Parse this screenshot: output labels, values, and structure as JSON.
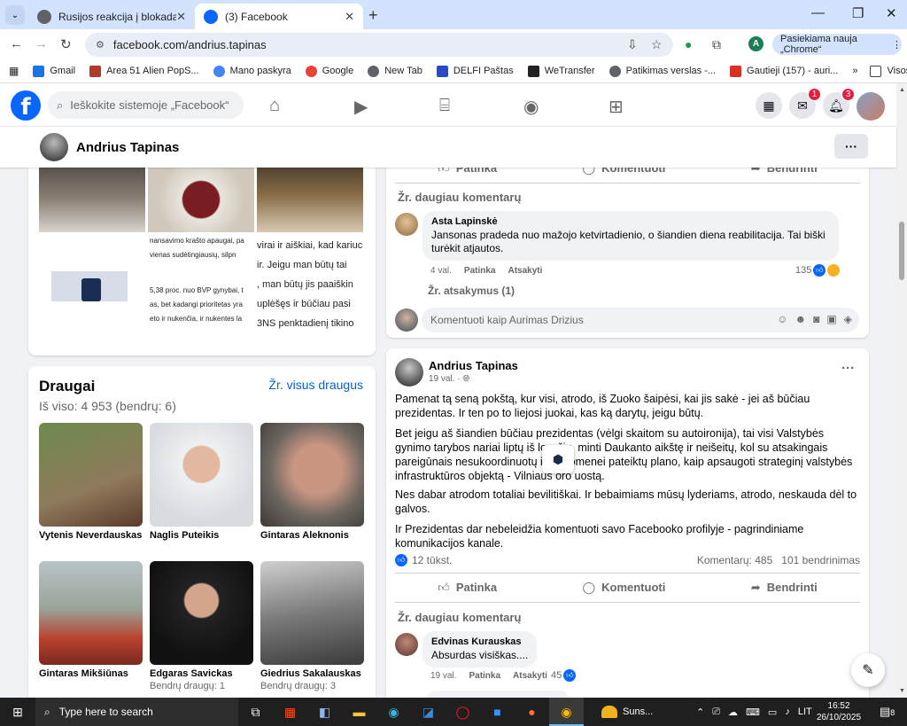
{
  "browser": {
    "tabs": [
      {
        "title": "Rusijos reakcija į blokadą",
        "active": false
      },
      {
        "title": "(3) Facebook",
        "active": true
      }
    ],
    "url": "facebook.com/andrius.tapinas",
    "profile_initial": "A",
    "update_label": "Pasiekiama nauja „Chrome“",
    "bookmarks": [
      "Gmail",
      "Area 51 Alien PopS...",
      "Mano paskyra",
      "Google",
      "New Tab",
      "DELFI Paštas",
      "WeTransfer",
      "Patikimas verslas -...",
      "Gautieji (157) - auri..."
    ],
    "all_bookmarks": "Visos žymės"
  },
  "facebook": {
    "search_placeholder": "Ieškokite sistemoje „Facebook“",
    "messenger_badge": "1",
    "notifications_badge": "3",
    "profile_name": "Andrius Tapinas",
    "accent": "#0866ff"
  },
  "photos": {
    "snippet_middle": [
      "nansavimo krašto apaugai, pa",
      "vienas sudėtingiausių, silpn",
      "",
      "5,38 proc. nuo BVP gynybai, t",
      "as, bet kadangi prioritetas yra",
      "eto ir nukenčia, ir nukentes la"
    ],
    "snippet_right": [
      "virai ir aiškiai, kad kariuc",
      "ir. Jeigu man būtų tai",
      ", man būtų jis paaiškin",
      "uplėšęs ir būčiau pasi",
      "3NS penktadienį tikino"
    ]
  },
  "friends": {
    "title": "Draugai",
    "see_all": "Žr. visus draugus",
    "count_text": "Iš viso: 4 953 (bendrų: 6)",
    "list": [
      {
        "name": "Vytenis Neverdauskas",
        "mutual": ""
      },
      {
        "name": "Naglis Puteikis",
        "mutual": ""
      },
      {
        "name": "Gintaras Aleknonis",
        "mutual": ""
      },
      {
        "name": "Gintaras Mikšiūnas",
        "mutual": ""
      },
      {
        "name": "Edgaras Savickas",
        "mutual": "Bendrų draugų: 1"
      },
      {
        "name": "Giedrius Sakalauskas",
        "mutual": "Bendrų draugų: 3"
      }
    ]
  },
  "post1": {
    "actions": {
      "like": "Patinka",
      "comment": "Komentuoti",
      "share": "Bendrinti"
    },
    "more_comments": "Žr. daugiau komentarų",
    "comment": {
      "author": "Asta Lapinskė",
      "text": "Jansonas pradeda nuo mažojo ketvirtadienio, o šiandien diena reabilitacija. Tai biški turėkit atjautos.",
      "time": "4 val.",
      "like": "Patinka",
      "reply": "Atsakyti",
      "reactions": "135"
    },
    "replies": "Žr. atsakymus (1)",
    "comment_placeholder": "Komentuoti kaip Aurimas Drizius"
  },
  "post2": {
    "author": "Andrius Tapinas",
    "time": "19 val. ·",
    "paragraphs": [
      "Pamenat tą seną pokštą, kur visi, atrodo, iš Zuoko šaipėsi, kai jis sakė - jei aš būčiau prezidentas. Ir ten po to liejosi juokai, kas ką darytų, jeigu būtų.",
      "Bet jeigu aš šiandien būčiau prezidentas (vėlgi skaitom su autoironija), tai visi Valstybės gynimo tarybos nariai liptų iš lovyčių, minti Daukanto aikštę ir neišeitų, kol su atsakingais pareigūnais nesukoordinuotų ir visuomenei pateiktų plano, kaip apsaugoti strateginį valstybės infrastruktūros objektą - Vilniaus oro uostą.",
      "Nes dabar atrodom totaliai bevilitiškai. Ir bebaimiams mūsų lyderiams, atrodo, neskauda dėl to galvos.",
      "Ir Prezidentas dar nebeleidžia komentuoti savo Facebooko profilyje - pagrindiniame komunikacijos kanale."
    ],
    "likes": "12 tūkst.",
    "comments_count": "Komentarų: 485",
    "shares_count": "101 bendrinimas",
    "actions": {
      "like": "Patinka",
      "comment": "Komentuoti",
      "share": "Bendrinti"
    },
    "more_comments": "Žr. daugiau komentarų",
    "comment": {
      "author": "Edvinas Kurauskas",
      "text": "Absurdas visiškas....",
      "time": "19 val.",
      "like": "Patinka",
      "reply": "Atsakyti",
      "reactions": "45"
    }
  },
  "taskbar": {
    "search_placeholder": "Type here to search",
    "weather": "Suns...",
    "language": "LIT",
    "time": "16:52",
    "date": "26/10/2025",
    "notifications": "8"
  }
}
